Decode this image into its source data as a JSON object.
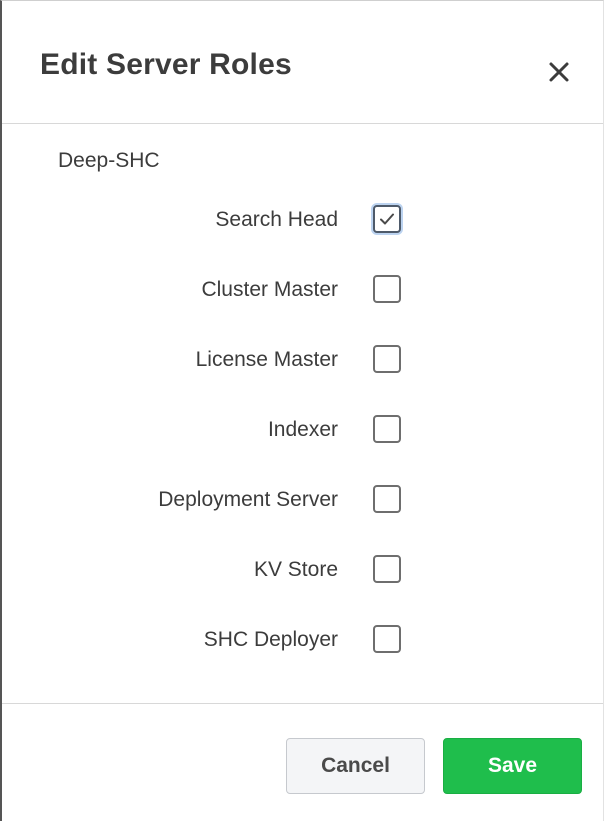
{
  "dialog": {
    "title": "Edit Server Roles",
    "close_icon": "close-icon"
  },
  "server": {
    "name": "Deep-SHC"
  },
  "roles": [
    {
      "label": "Search Head",
      "checked": true
    },
    {
      "label": "Cluster Master",
      "checked": false
    },
    {
      "label": "License Master",
      "checked": false
    },
    {
      "label": "Indexer",
      "checked": false
    },
    {
      "label": "Deployment Server",
      "checked": false
    },
    {
      "label": "KV Store",
      "checked": false
    },
    {
      "label": "SHC Deployer",
      "checked": false
    }
  ],
  "footer": {
    "cancel_label": "Cancel",
    "save_label": "Save"
  },
  "colors": {
    "save_button": "#1fbe4c",
    "checkbox_focus": "#bcd3f0"
  }
}
